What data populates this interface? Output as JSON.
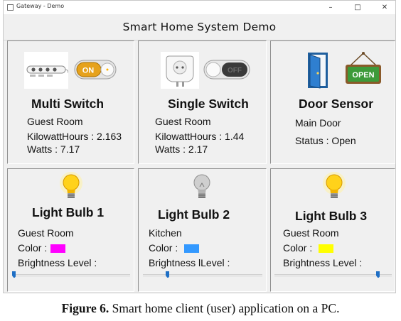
{
  "window": {
    "title": "Gateway - Demo",
    "minimize": "–",
    "maximize": "□",
    "close": "✕"
  },
  "app": {
    "title": "Smart Home System Demo"
  },
  "devices": [
    {
      "title": "Multi Switch",
      "room": "Guest Room",
      "kwh": "KilowattHours : 2.163",
      "watts": "Watts : 7.17",
      "toggle": "ON"
    },
    {
      "title": "Single Switch",
      "room": "Guest Room",
      "kwh": "KilowattHours : 1.44",
      "watts": "Watts : 2.17",
      "toggle": "OFF"
    },
    {
      "title": "Door Sensor",
      "location": "Main Door",
      "status": "Status : Open",
      "sign": "OPEN"
    }
  ],
  "bulbs": [
    {
      "title": "Light Bulb 1",
      "room": "Guest Room",
      "color_label": "Color :",
      "color": "#ff00ff",
      "brightness_label": "Brightness Level :",
      "brightness": 0.0,
      "lit": true
    },
    {
      "title": "Light Bulb 2",
      "room": "Kitchen",
      "color_label": "Color :",
      "color": "#3399ff",
      "brightness_label": "Brightness lLevel :",
      "brightness": 0.2,
      "lit": false
    },
    {
      "title": "Light Bulb 3",
      "room": "Guest Room",
      "color_label": "Color :",
      "color": "#ffff00",
      "brightness_label": "Brightness Level :",
      "brightness": 0.9,
      "lit": true
    }
  ],
  "caption": {
    "label": "Figure 6.",
    "text": " Smart home client (user) application on a PC."
  },
  "icons": [
    "power-strip-icon",
    "toggle-on-icon",
    "smart-plug-icon",
    "toggle-off-icon",
    "door-icon",
    "open-sign-icon",
    "bulb-lit-icon",
    "bulb-off-icon",
    "slider-thumb-icon"
  ]
}
